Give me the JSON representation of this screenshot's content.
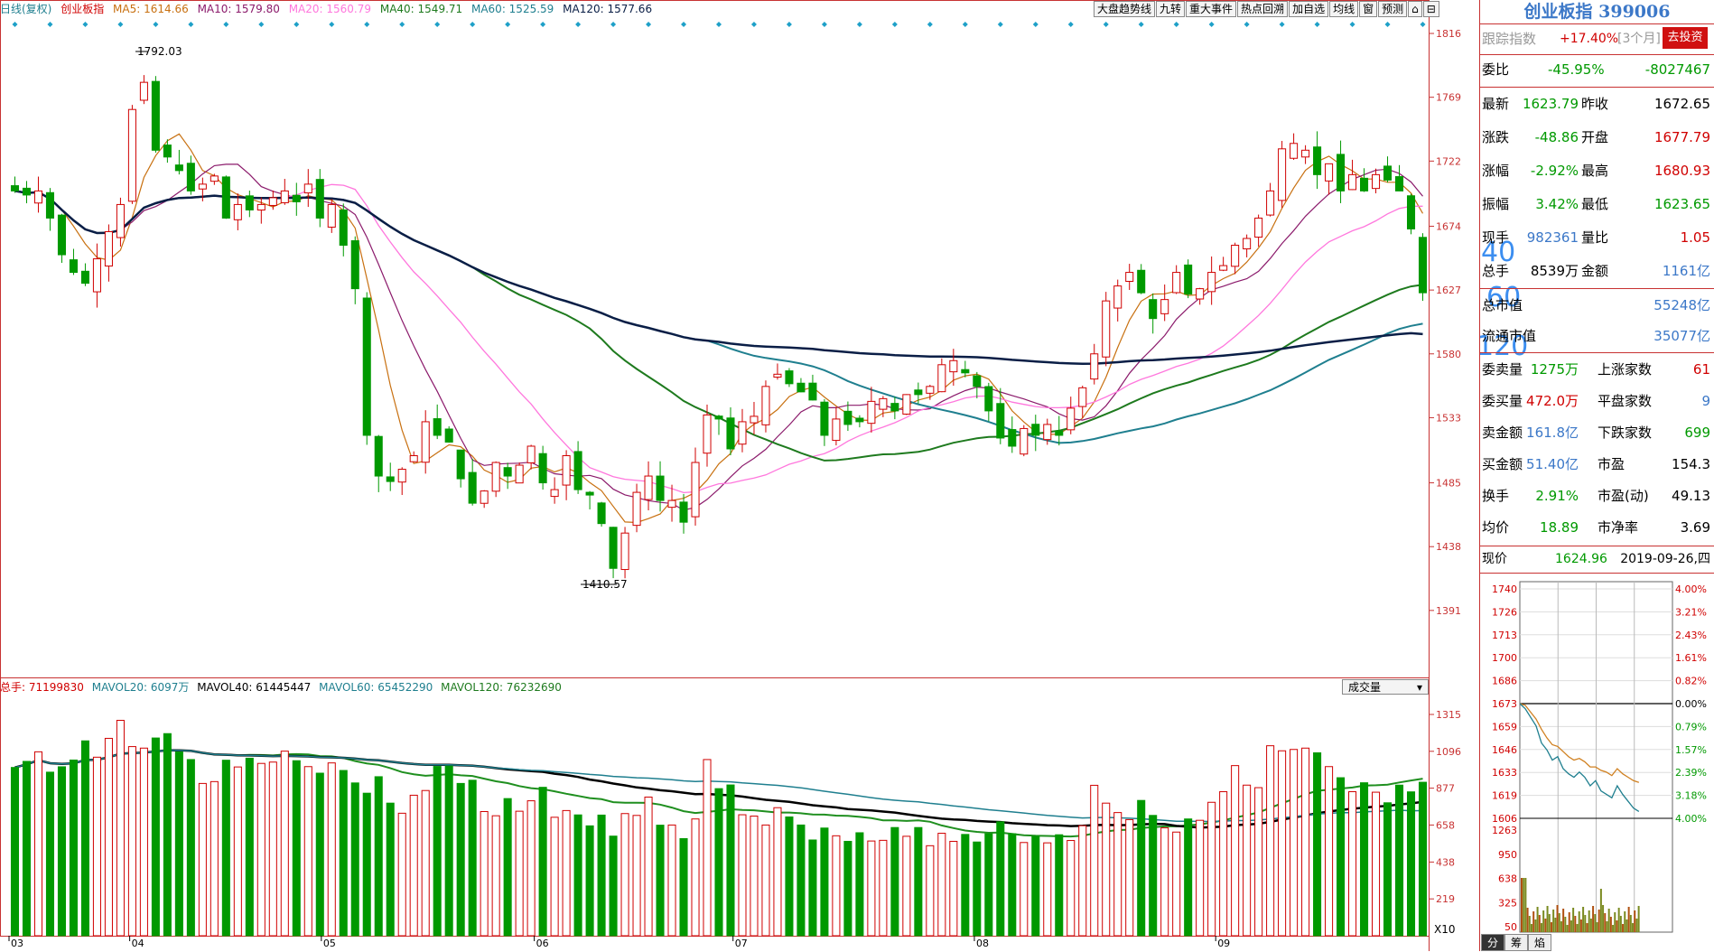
{
  "header": {
    "period": "日线(复权)",
    "name": "创业板指",
    "ma": [
      {
        "label": "MA5: 1614.66",
        "color": "#c87010"
      },
      {
        "label": "MA10: 1579.80",
        "color": "#8b1a6b"
      },
      {
        "label": "MA20: 1560.79",
        "color": "#ff77dd"
      },
      {
        "label": "MA40: 1549.71",
        "color": "#1e7a1e"
      },
      {
        "label": "MA60: 1525.59",
        "color": "#1f7f8f"
      },
      {
        "label": "MA120: 1577.66",
        "color": "#0a1e46"
      }
    ]
  },
  "toolbar": [
    "大盘趋势线",
    "九转",
    "重大事件",
    "热点回溯",
    "加自选",
    "均线",
    "窗",
    "预测"
  ],
  "volume_header": {
    "items": [
      {
        "label": "总手: 71199830",
        "color": "#d00000"
      },
      {
        "label": "MAVOL20: 6097万",
        "color": "#1f7f8f"
      },
      {
        "label": "MAVOL40: 61445447",
        "color": "#000000"
      },
      {
        "label": "MAVOL60: 65452290",
        "color": "#1f7f8f"
      },
      {
        "label": "MAVOL120: 76232690",
        "color": "#1e7a1e"
      }
    ],
    "dropdown": "成交量",
    "scale_unit": "X10"
  },
  "colors": {
    "up": "#d00000",
    "down": "#009900",
    "axis": "#c83232"
  },
  "x_labels": [
    "03",
    "04",
    "05",
    "06",
    "07",
    "08",
    "09"
  ],
  "annotations": {
    "high": "1792.03",
    "low": "1410.57",
    "overlay_ma": [
      "40",
      "60",
      "120"
    ]
  },
  "chart_data": [
    {
      "type": "candlestick",
      "title": "创业板指 日线(复权)",
      "x": [
        "03",
        "04",
        "05",
        "06",
        "07",
        "08",
        "09"
      ],
      "y_ticks": [
        1816,
        1769,
        1722,
        1674,
        1627,
        1580,
        1533,
        1485,
        1438,
        1391
      ],
      "ylim": [
        1345,
        1826
      ],
      "grid": false,
      "series": [
        {
          "name": "MA5",
          "latest": 1614.66
        },
        {
          "name": "MA10",
          "latest": 1579.8
        },
        {
          "name": "MA20",
          "latest": 1560.79
        },
        {
          "name": "MA40",
          "latest": 1549.71
        },
        {
          "name": "MA60",
          "latest": 1525.59
        },
        {
          "name": "MA120",
          "latest": 1577.66
        }
      ],
      "close_guide": [
        1700,
        1697,
        1700,
        1680,
        1653,
        1640,
        1632,
        1650,
        1670,
        1690,
        1760,
        1780,
        1730,
        1725,
        1715,
        1700,
        1705,
        1711,
        1680,
        1690,
        1686,
        1690,
        1695,
        1700,
        1692,
        1705,
        1680,
        1690,
        1660,
        1628,
        1520,
        1490,
        1486,
        1495,
        1505,
        1530,
        1520,
        1515,
        1488,
        1470,
        1479,
        1500,
        1490,
        1498,
        1512,
        1485,
        1480,
        1505,
        1480,
        1476,
        1455,
        1422,
        1448,
        1478,
        1490,
        1472,
        1472,
        1456,
        1500,
        1535,
        1532,
        1510,
        1530,
        1534,
        1556,
        1565,
        1558,
        1552,
        1546,
        1520,
        1532,
        1528,
        1530,
        1545,
        1547,
        1538,
        1550,
        1550,
        1556,
        1572,
        1575,
        1566,
        1556,
        1538,
        1518,
        1512,
        1525,
        1520,
        1528,
        1520,
        1540,
        1555,
        1580,
        1619,
        1630,
        1640,
        1625,
        1606,
        1620,
        1640,
        1624,
        1628,
        1640,
        1645,
        1660,
        1665,
        1680,
        1700,
        1731,
        1735,
        1730,
        1712,
        1720,
        1700,
        1712,
        1700,
        1712,
        1708,
        1700,
        1672,
        1625
      ]
    },
    {
      "type": "bar",
      "title": "成交量",
      "y_ticks": [
        1315,
        1096,
        877,
        658,
        438,
        219
      ],
      "ylim": [
        0,
        1315
      ],
      "series": [
        {
          "name": "成交量",
          "values": [
            1000,
            1036,
            1093,
            972,
            1004,
            1044,
            1158,
            1061,
            1173,
            1280,
            1124,
            1115,
            1175,
            1201,
            1092,
            1047,
            905,
            916,
            1043,
            1003,
            1055,
            1024,
            1032,
            1097,
            1040,
            1005,
            966,
            1027,
            982,
            908,
            847,
            945,
            788,
            728,
            835,
            863,
            1006,
            1008,
            905,
            924,
            738,
            713,
            815,
            740,
            802,
            882,
            704,
            744,
            718,
            653,
            717,
            592,
            726,
            715,
            824,
            657,
            658,
            577,
            694,
            1047,
            874,
            896,
            719,
            711,
            658,
            761,
            706,
            658,
            569,
            640,
            594,
            561,
            612,
            563,
            567,
            643,
            591,
            643,
            535,
            609,
            561,
            602,
            557,
            606,
            677,
            606,
            554,
            590,
            552,
            600,
            566,
            654,
            894,
            788,
            732,
            690,
            804,
            715,
            641,
            616,
            694,
            686,
            793,
            856,
            1011,
            895,
            880,
            1129,
            1099,
            1107,
            1115,
            1087,
            1005,
            939,
            856,
            909,
            853,
            790,
            895,
            855,
            912
          ]
        },
        {
          "name": "MAVOL20",
          "latest": 609.7
        },
        {
          "name": "MAVOL40",
          "latest": 614.45
        },
        {
          "name": "MAVOL60",
          "latest": 654.52
        },
        {
          "name": "MAVOL120",
          "latest": 762.33
        }
      ]
    },
    {
      "type": "line",
      "title": "分时",
      "y_ticks_left": [
        1740,
        1726,
        1713,
        1700,
        1686,
        1673,
        1659,
        1646,
        1633,
        1619,
        1606
      ],
      "y_ticks_right": [
        "4.00%",
        "3.21%",
        "2.43%",
        "1.61%",
        "0.82%",
        "0.00%",
        "0.79%",
        "1.57%",
        "2.39%",
        "3.18%",
        "4.00%"
      ],
      "volume_ticks": [
        1263,
        950,
        638,
        325,
        50
      ],
      "series": [
        {
          "name": "创业板指",
          "values": [
            1673,
            1670,
            1665,
            1660,
            1650,
            1646,
            1640,
            1642,
            1635,
            1632,
            1630,
            1633,
            1630,
            1625,
            1628,
            1622,
            1620,
            1618,
            1625,
            1620,
            1616,
            1612,
            1610
          ]
        },
        {
          "name": "均价",
          "values": [
            1673,
            1672,
            1668,
            1664,
            1658,
            1653,
            1649,
            1648,
            1645,
            1642,
            1640,
            1641,
            1639,
            1636,
            1636,
            1634,
            1633,
            1631,
            1635,
            1632,
            1630,
            1628,
            1627
          ]
        }
      ]
    }
  ],
  "side_panel": {
    "title": "创业板指 399006",
    "track": {
      "label": "跟踪指数",
      "value": "+17.40%",
      "period": "[3个月]",
      "button": "去投资"
    },
    "weibi": {
      "label": "委比",
      "pct": "-45.95%",
      "value": "-8027467"
    },
    "quote": [
      {
        "l1": "最新",
        "v1": "1623.79",
        "c1": "grn",
        "l2": "昨收",
        "v2": "1672.65",
        "c2": ""
      },
      {
        "l1": "涨跌",
        "v1": "-48.86",
        "c1": "grn",
        "l2": "开盘",
        "v2": "1677.79",
        "c2": "red"
      },
      {
        "l1": "涨幅",
        "v1": "-2.92%",
        "c1": "grn",
        "l2": "最高",
        "v2": "1680.93",
        "c2": "red"
      },
      {
        "l1": "振幅",
        "v1": "3.42%",
        "c1": "grn",
        "l2": "最低",
        "v2": "1623.65",
        "c2": "grn"
      },
      {
        "l1": "现手",
        "v1": "982361",
        "c1": "blu",
        "l2": "量比",
        "v2": "1.05",
        "c2": "red"
      },
      {
        "l1": "总手",
        "v1": "8539万",
        "c1": "",
        "l2": "金额",
        "v2": "1161亿",
        "c2": "blu"
      }
    ],
    "cap": [
      {
        "l": "总市值",
        "v": "55248亿"
      },
      {
        "l": "流通市值",
        "v": "35077亿"
      }
    ],
    "stats": [
      {
        "l1": "委卖量",
        "v1": "1275万",
        "c1": "grn",
        "l2": "上涨家数",
        "v2": "61",
        "c2": "red"
      },
      {
        "l1": "委买量",
        "v1": "472.0万",
        "c1": "red",
        "l2": "平盘家数",
        "v2": "9",
        "c2": "blu"
      },
      {
        "l1": "卖金额",
        "v1": "161.8亿",
        "c1": "blu",
        "l2": "下跌家数",
        "v2": "699",
        "c2": "grn"
      },
      {
        "l1": "买金额",
        "v1": "51.40亿",
        "c1": "blu",
        "l2": "市盈",
        "v2": "154.3",
        "c2": ""
      },
      {
        "l1": "换手",
        "v1": "2.91%",
        "c1": "grn",
        "l2": "市盈(动)",
        "v2": "49.13",
        "c2": ""
      },
      {
        "l1": "均价",
        "v1": "18.89",
        "c1": "grn",
        "l2": "市净率",
        "v2": "3.69",
        "c2": ""
      }
    ],
    "price": {
      "label": "现价",
      "value": "1624.96",
      "date": "2019-09-26,四"
    },
    "tabs": [
      "分",
      "筹",
      "焰"
    ]
  }
}
